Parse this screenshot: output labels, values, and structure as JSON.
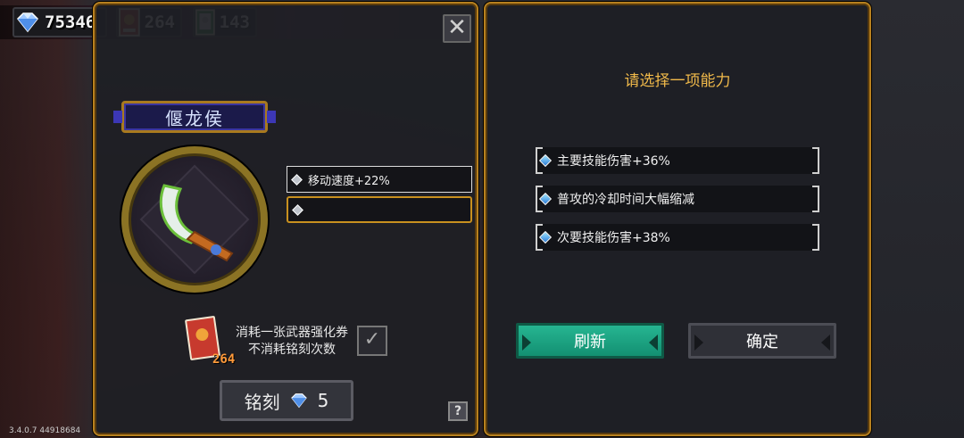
{
  "currency": {
    "gems": "75346",
    "weapon_tickets": "264",
    "cards": "143"
  },
  "left_panel": {
    "weapon_name": "偃龙侯",
    "attributes": [
      {
        "label": "移动速度+22%",
        "selected": false
      },
      {
        "label": "",
        "selected": true
      }
    ],
    "cost_line1": "消耗一张武器强化券",
    "cost_line2": "不消耗铭刻次数",
    "ticket_count": "264",
    "engrave_button": {
      "label": "铭刻",
      "cost": "5"
    },
    "help_label": "?"
  },
  "right_panel": {
    "title": "请选择一项能力",
    "options": [
      {
        "label": "主要技能伤害+36%"
      },
      {
        "label": "普攻的冷却时间大幅缩减"
      },
      {
        "label": "次要技能伤害+38%"
      }
    ],
    "refresh_label": "刷新",
    "confirm_label": "确定"
  },
  "version": "3.4.0.7 44918684",
  "colors": {
    "gold_border": "#b7801e",
    "title_yellow": "#f0b94a",
    "refresh_green": "#1fa584",
    "panel_bg": "#1e1f25"
  },
  "icons": [
    "gem-icon",
    "weapon-ticket-icon",
    "card-icon",
    "close-icon",
    "diamond-bullet-icon",
    "help-icon",
    "checkbox-icon"
  ]
}
